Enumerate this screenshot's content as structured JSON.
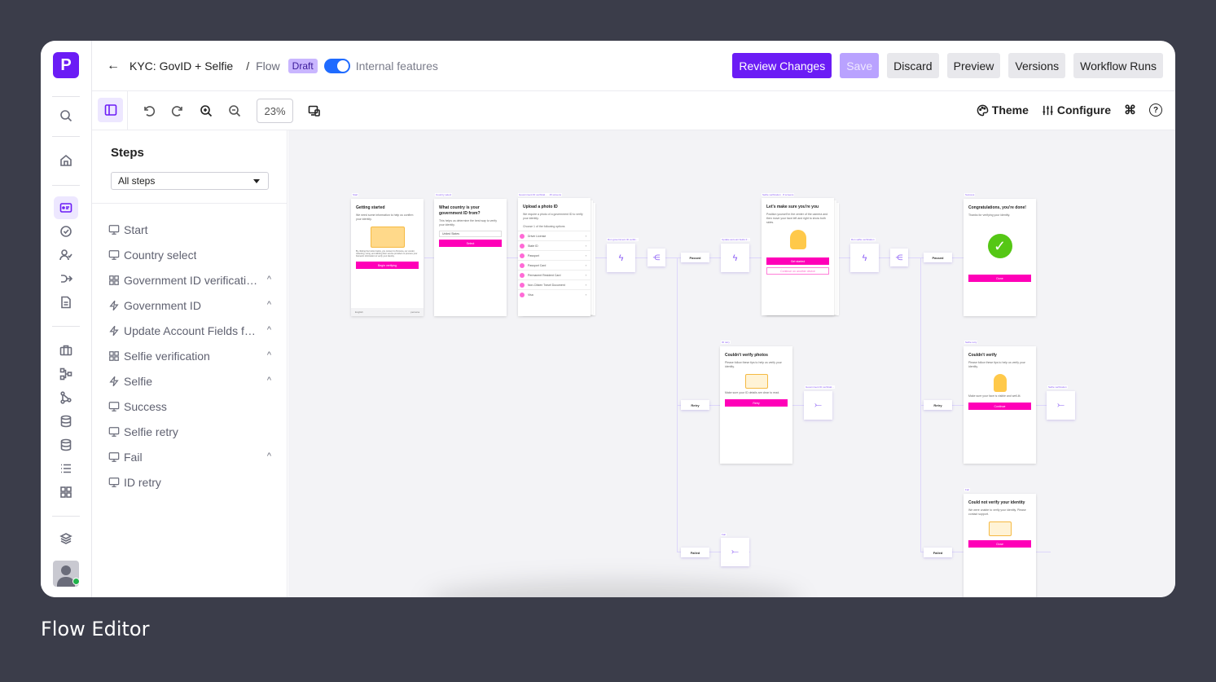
{
  "caption": "Flow Editor",
  "app": {
    "logo_letter": "P"
  },
  "rail": {
    "items": [
      {
        "name": "search",
        "icon": "search-icon"
      },
      {
        "name": "home",
        "icon": "home-icon"
      },
      {
        "name": "inquiries",
        "icon": "id-card-icon",
        "active": true
      },
      {
        "name": "verifications",
        "icon": "check-circle-icon"
      },
      {
        "name": "accounts",
        "icon": "user-check-icon"
      },
      {
        "name": "transactions",
        "icon": "route-icon"
      },
      {
        "name": "reports",
        "icon": "document-icon"
      },
      {
        "name": "cases",
        "icon": "briefcase-icon"
      },
      {
        "name": "workflows",
        "icon": "workflow-icon"
      },
      {
        "name": "graph",
        "icon": "graph-icon"
      },
      {
        "name": "data-1",
        "icon": "database-icon"
      },
      {
        "name": "data-2",
        "icon": "database-icon"
      },
      {
        "name": "lists",
        "icon": "list-icon"
      },
      {
        "name": "integrations",
        "icon": "grid-icon"
      },
      {
        "name": "layers",
        "icon": "layers-icon"
      }
    ]
  },
  "header": {
    "back_label": "←",
    "title": "KYC: GovID + Selfie",
    "separator": "/",
    "section": "Flow",
    "status_badge": "Draft",
    "toggle_label": "Internal features",
    "toggle_on": true,
    "buttons": {
      "review": "Review Changes",
      "save": "Save",
      "discard": "Discard",
      "preview": "Preview",
      "versions": "Versions",
      "runs": "Workflow Runs"
    }
  },
  "toolbar": {
    "zoom": "23%",
    "theme": "Theme",
    "configure": "Configure",
    "shortcut_glyph": "⌘",
    "help_glyph": "?"
  },
  "steps": {
    "title": "Steps",
    "filter": "All steps",
    "items": [
      {
        "label": "Start",
        "icon": "monitor-icon",
        "collapsible": false
      },
      {
        "label": "Country select",
        "icon": "monitor-icon",
        "collapsible": false
      },
      {
        "label": "Government ID verification",
        "icon": "grid-icon",
        "collapsible": true
      },
      {
        "label": "Government ID",
        "icon": "bolt-icon",
        "collapsible": true
      },
      {
        "label": "Update Account Fields from Government ID",
        "icon": "bolt-icon",
        "collapsible": true
      },
      {
        "label": "Selfie verification",
        "icon": "grid-icon",
        "collapsible": true
      },
      {
        "label": "Selfie",
        "icon": "bolt-icon",
        "collapsible": true
      },
      {
        "label": "Success",
        "icon": "monitor-icon",
        "collapsible": false
      },
      {
        "label": "Selfie retry",
        "icon": "monitor-icon",
        "collapsible": false
      },
      {
        "label": "Fail",
        "icon": "monitor-icon",
        "collapsible": true
      },
      {
        "label": "ID retry",
        "icon": "monitor-icon",
        "collapsible": false
      }
    ]
  },
  "canvas": {
    "start": {
      "label": "Start",
      "title": "Getting started",
      "text": "We need some information to help us confirm your identity.",
      "legal": "By clicking the button below, you consent to Persona, our vendor, collecting, using, and utilizing their service providers to process your biometric information to verify your identity.",
      "button": "Begin verifying",
      "footer_lang": "English",
      "footer_brand": "persona"
    },
    "country": {
      "label": "Country select",
      "title": "What country is your government ID from?",
      "text": "This helps us determine the best way to verify your identity.",
      "select_value": "United States",
      "button": "Select"
    },
    "govid": {
      "label": "Government ID verificati... · 15 screens",
      "title": "Upload a photo ID",
      "text": "We require a photo of a government ID to verify your identity.",
      "choose": "Choose 1 of the following options",
      "options": [
        "Driver License",
        "State ID",
        "Passport",
        "Passport Card",
        "Permanent Resident Card",
        "Non-Citizen Travel Document",
        "Visa"
      ]
    },
    "govid_action": {
      "label": "Run government ID verific..."
    },
    "update_action": {
      "label": "Update account fields fr..."
    },
    "selfie": {
      "label": "Selfie verification · 8 screens",
      "title": "Let's make sure you're you",
      "text": "Position yourself in the center of the camera and then move your face left and right to show both sides.",
      "button": "Get started",
      "secondary_button": "Continue on another device"
    },
    "selfie_action": {
      "label": "Run selfie verification"
    },
    "success": {
      "label": "Success",
      "title": "Congratulations, you're done!",
      "text": "Thanks for verifying your identity.",
      "button": "Done"
    },
    "id_retry": {
      "label": "ID retry",
      "title": "Couldn't verify photos",
      "text": "Please follow these tips to help us verify your identity.",
      "tip": "Make sure your ID details are clear to read.",
      "button": "Retry"
    },
    "selfie_retry": {
      "label": "Selfie retry",
      "title": "Couldn't verify",
      "text": "Please follow these tips to help us verify your identity.",
      "tip": "Make sure your face is visible and well-lit.",
      "button": "Continue"
    },
    "fail": {
      "label": "Fail",
      "title": "Could not verify your identity",
      "text": "We were unable to verify your identity. Please contact support.",
      "button": "Close"
    },
    "goto_govid": {
      "label": "Government ID verificati..."
    },
    "goto_selfie": {
      "label": "Selfie verification"
    },
    "goto_fail": {
      "label": "Fail"
    },
    "branches": {
      "passed": "Passed",
      "retry": "Retry",
      "failed": "Failed"
    }
  }
}
